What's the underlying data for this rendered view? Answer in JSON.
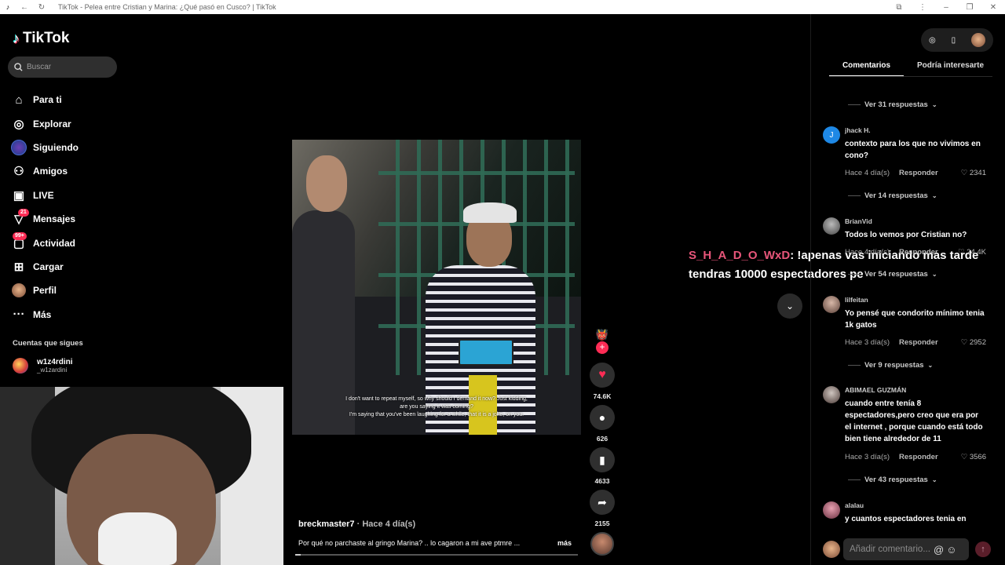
{
  "browser": {
    "title": "TikTok - Pelea entre Cristian y Marina: ¿Qué pasó en Cusco? | TikTok"
  },
  "sidebar": {
    "logo": "TikTok",
    "search_placeholder": "Buscar",
    "items": [
      {
        "label": "Para ti",
        "icon": "home-icon"
      },
      {
        "label": "Explorar",
        "icon": "compass-icon"
      },
      {
        "label": "Siguiendo",
        "icon": "following-avatar-icon"
      },
      {
        "label": "Amigos",
        "icon": "friends-icon"
      },
      {
        "label": "LIVE",
        "icon": "live-tv-icon"
      },
      {
        "label": "Mensajes",
        "icon": "send-icon",
        "badge": "21"
      },
      {
        "label": "Actividad",
        "icon": "inbox-icon",
        "badge": "99+"
      },
      {
        "label": "Cargar",
        "icon": "plus-square-icon"
      },
      {
        "label": "Perfil",
        "icon": "profile-avatar-icon"
      },
      {
        "label": "Más",
        "icon": "more-dots-icon"
      }
    ],
    "following_header": "Cuentas que sigues",
    "following": [
      {
        "name": "w1z4rdini",
        "username": "_w1zardini"
      }
    ]
  },
  "video": {
    "subtitles": [
      "I don't want to repeat myself, so why should I demand it now? Just kidding,",
      "are you saying it was coming?",
      "I'm saying that you've been laughing for a while, that it is a joke, on you."
    ],
    "author": "breckmaster7",
    "posted": "Hace 4 día(s)",
    "caption": "Por qué no parchaste al gringo Marina? .. lo cagaron a mi ave ptmre ...",
    "more_label": "más",
    "progress": 0.02
  },
  "actions": {
    "likes": "74.6K",
    "comments": "626",
    "saves": "4633",
    "shares": "2155"
  },
  "overlay": {
    "user": "S_H_A_D_O_WxD",
    "message": ": !apenas vas iniciando mas tarde tendras 10000 espectadores pe"
  },
  "panel": {
    "tabs": [
      "Comentarios",
      "Podría interesarte"
    ],
    "reply_label": "Responder",
    "comments": [
      {
        "replies": "Ver 31 respuestas"
      },
      {
        "name": "jhack H.",
        "text": "contexto para los que no vivimos en cono?",
        "time": "Hace 4 día(s)",
        "likes": "2341",
        "replies": "Ver 14 respuestas",
        "avatar_color": "#1e88e5",
        "initial": "J"
      },
      {
        "name": "BrianVid",
        "text": "Todos lo vemos por Cristian no?",
        "time": "Hace 4 día(s)",
        "likes": "24.4K",
        "replies": "Ver 54 respuestas",
        "avatar_color": "#888888"
      },
      {
        "name": "lilfeitan",
        "text": "Yo pensé que condorito mínimo tenia 1k gatos",
        "time": "Hace 3 día(s)",
        "likes": "2952",
        "replies": "Ver 9 respuestas",
        "avatar_color": "#8a7060"
      },
      {
        "name": "ABIMAEL GUZMÁN",
        "text": "cuando entre tenía 8 espectadores,pero creo que era por el internet , porque cuando está todo bien tiene alrededor de 11",
        "time": "Hace 3 día(s)",
        "likes": "3566",
        "replies": "Ver 43 respuestas",
        "avatar_color": "#6a5a55"
      },
      {
        "name": "alalau",
        "text": "y cuantos espectadores tenia en",
        "avatar_color": "#c0607a"
      }
    ],
    "composer_placeholder": "Añadir comentario..."
  }
}
